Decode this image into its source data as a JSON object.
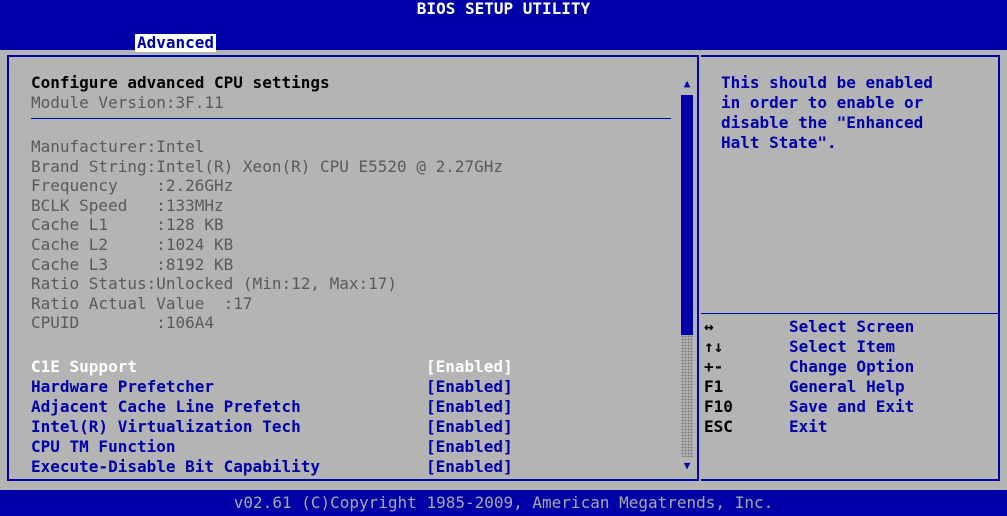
{
  "title": "BIOS SETUP UTILITY",
  "menu": {
    "active_tab": "Advanced"
  },
  "main": {
    "heading": "Configure advanced CPU settings",
    "module_version": "Module Version:3F.11",
    "info_lines": [
      "Manufacturer:Intel",
      "Brand String:Intel(R) Xeon(R) CPU E5520 @ 2.27GHz",
      "Frequency    :2.26GHz",
      "BCLK Speed   :133MHz",
      "Cache L1     :128 KB",
      "Cache L2     :1024 KB",
      "Cache L3     :8192 KB",
      "Ratio Status:Unlocked (Min:12, Max:17)",
      "Ratio Actual Value  :17",
      "CPUID        :106A4"
    ],
    "options": [
      {
        "label": "C1E Support",
        "value": "[Enabled]",
        "selected": true
      },
      {
        "label": "Hardware Prefetcher",
        "value": "[Enabled]",
        "selected": false
      },
      {
        "label": "Adjacent Cache Line Prefetch",
        "value": "[Enabled]",
        "selected": false
      },
      {
        "label": "Intel(R) Virtualization Tech",
        "value": "[Enabled]",
        "selected": false
      },
      {
        "label": "CPU TM Function",
        "value": "[Enabled]",
        "selected": false
      },
      {
        "label": "Execute-Disable Bit Capability",
        "value": "[Enabled]",
        "selected": false
      }
    ]
  },
  "help": {
    "text": "This should be enabled\nin order to enable or\ndisable the \"Enhanced\nHalt State\".",
    "keys": [
      {
        "key": "↔",
        "desc": "Select Screen"
      },
      {
        "key": "↑↓",
        "desc": "Select Item"
      },
      {
        "key": "+-",
        "desc": "Change Option"
      },
      {
        "key": "F1",
        "desc": "General Help"
      },
      {
        "key": "F10",
        "desc": "Save and Exit"
      },
      {
        "key": "ESC",
        "desc": "Exit"
      }
    ]
  },
  "footer": "v02.61 (C)Copyright 1985-2009, American Megatrends, Inc.",
  "colors": {
    "background": "#b4b4b4",
    "accent": "#0000a8",
    "highlight": "#ffffff",
    "dim_text": "#5a5a5a"
  }
}
